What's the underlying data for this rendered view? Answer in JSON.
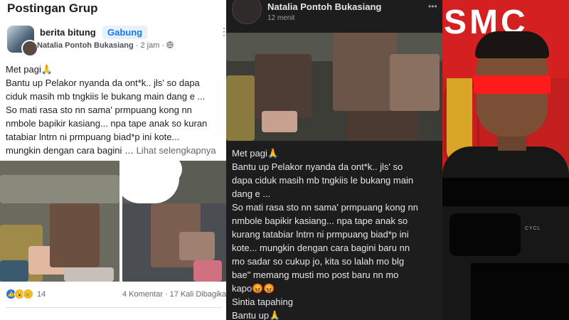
{
  "left_post": {
    "header": "Postingan Grup",
    "group_name": "berita bitung",
    "join_label": "Gabung",
    "more_icon": "more-dots-icon",
    "author": "Natalia Pontoh Bukasiang",
    "time": "2 jam",
    "separator": "·",
    "privacy_icon": "globe-icon",
    "lines": [
      "Met pagi🙏",
      "Bantu up Pelakor nyanda da ont*k.. jls' so dapa",
      "ciduk masih mb tngkiis le bukang main dang e ...",
      "So mati rasa sto nn sama' prmpuang kong nn",
      "nmbole bapikir kasiang... npa tape anak so kuran",
      "tatabiar lntrn ni prmpuang biad*p ini kote...",
      "mungkin dengan cara bagini …"
    ],
    "see_more": "Lihat selengkapnya",
    "reaction_count": "14",
    "comments": "4 Komentar",
    "shares": "17 Kali Dibagikan"
  },
  "mid_post": {
    "author": "Natalia Pontoh Bukasiang",
    "time": "12 menit",
    "more_icon": "more-dots-icon",
    "lines": [
      "Met pagi🙏",
      "Bantu up Pelakor nyanda da ont*k.. jls' so",
      "dapa ciduk masih mb tngkiis le bukang main",
      "dang e ...",
      "So mati rasa sto nn sama' prmpuang kong nn",
      "nmbole bapikir kasiang... npa tape anak so",
      "kurang tatabiar lntrn ni prmpuang biad*p ini",
      "kote... mungkin dengan cara bagini baru nn",
      "mo sadar so cukup jo, kita so lalah mo blg",
      "bae\" memang musti mo post baru nn mo",
      "kapo😡😡",
      "Sintia tapahing",
      "Bantu up🙏"
    ]
  },
  "right_photo": {
    "banner_text": "SMC",
    "shirt_text": "CYCL"
  },
  "colors": {
    "facebook_blue": "#1877f2",
    "censor_red": "#ff1b1b",
    "banner_red": "#d42020",
    "dark_bg": "#1d1d1d"
  }
}
